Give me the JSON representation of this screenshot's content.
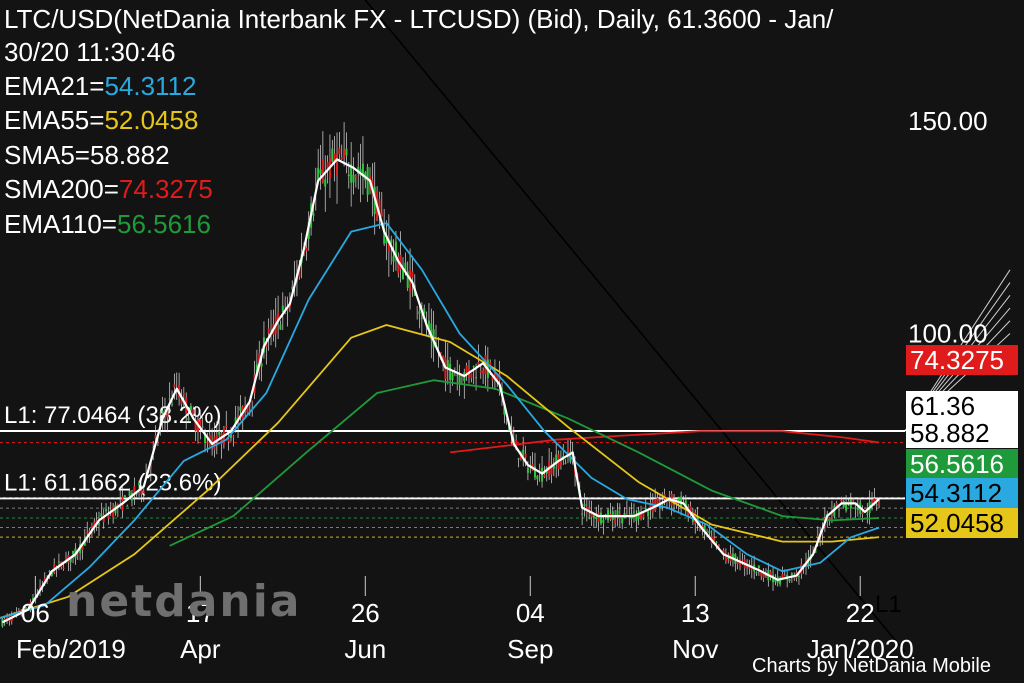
{
  "header": {
    "title": "LTC/USD(NetDania Interbank FX - LTCUSD) (Bid),  Daily, 61.3600 - Jan/",
    "timestamp": "30/20 11:30:46"
  },
  "indicators": [
    {
      "name": "EMA21=",
      "value": "54.3112",
      "color": "#29a9e0"
    },
    {
      "name": "EMA55=",
      "value": "52.0458",
      "color": "#e6c619"
    },
    {
      "name": "SMA5=",
      "value": "58.882",
      "color": "#ffffff"
    },
    {
      "name": "SMA200=",
      "value": "74.3275",
      "color": "#e01b1b"
    },
    {
      "name": "EMA110=",
      "value": "56.5616",
      "color": "#1e9a3a"
    }
  ],
  "fib_levels": [
    {
      "label": "L1: 77.0464 (38.2%)",
      "value": 77.0464
    },
    {
      "label": "L1: 61.1662 (23.6%)",
      "value": 61.1662
    }
  ],
  "trendline_label": "L1",
  "price_tags": [
    {
      "text": "74.3275",
      "value": 74.3275,
      "bg": "#e01b1b",
      "fg": "#ffffff"
    },
    {
      "text": "61.36",
      "value": 61.36,
      "bg": "#ffffff",
      "fg": "#000000"
    },
    {
      "text": "58.882",
      "value": 58.882,
      "bg": "#ffffff",
      "fg": "#000000"
    },
    {
      "text": "56.5616",
      "value": 56.5616,
      "bg": "#1e9a3a",
      "fg": "#ffffff"
    },
    {
      "text": "54.3112",
      "value": 54.3112,
      "bg": "#29a9e0",
      "fg": "#000000"
    },
    {
      "text": "52.0458",
      "value": 52.0458,
      "bg": "#e6c619",
      "fg": "#000000"
    }
  ],
  "watermark": "netdania",
  "credit": "Charts by NetDania Mobile",
  "chart_data": {
    "type": "line",
    "title": "LTC/USD(NetDania Interbank FX - LTCUSD) (Bid),  Daily, 61.3600 - Jan/30/20 11:30:46",
    "y_ticks": [
      {
        "label": "150.00",
        "value": 150
      },
      {
        "label": "100.00",
        "value": 100
      }
    ],
    "x_ticks": [
      {
        "day": "06",
        "month": "Feb/2019",
        "date": "2019-02-06"
      },
      {
        "day": "17",
        "month": "Apr",
        "date": "2019-04-17"
      },
      {
        "day": "26",
        "month": "Jun",
        "date": "2019-06-26"
      },
      {
        "day": "04",
        "month": "Sep",
        "date": "2019-09-04"
      },
      {
        "day": "13",
        "month": "Nov",
        "date": "2019-11-13"
      },
      {
        "day": "22",
        "month": "Jan/2020",
        "date": "2020-01-22"
      }
    ],
    "x_range": [
      "2019-01-22",
      "2020-02-10"
    ],
    "y_range": [
      25,
      175
    ],
    "grid": false,
    "trendline": {
      "start": [
        "2019-05-25",
        200
      ],
      "end": [
        "2020-02-10",
        25
      ]
    },
    "series": [
      {
        "name": "SMA5",
        "color": "#ffffff",
        "points": [
          [
            "2019-01-23",
            32
          ],
          [
            "2019-02-03",
            35
          ],
          [
            "2019-02-13",
            44
          ],
          [
            "2019-02-23",
            48
          ],
          [
            "2019-03-05",
            56
          ],
          [
            "2019-03-15",
            60
          ],
          [
            "2019-03-24",
            64
          ],
          [
            "2019-04-01",
            80
          ],
          [
            "2019-04-07",
            87
          ],
          [
            "2019-04-14",
            80
          ],
          [
            "2019-04-22",
            74
          ],
          [
            "2019-04-30",
            77
          ],
          [
            "2019-05-08",
            84
          ],
          [
            "2019-05-14",
            97
          ],
          [
            "2019-05-20",
            103
          ],
          [
            "2019-05-25",
            107
          ],
          [
            "2019-05-31",
            120
          ],
          [
            "2019-06-06",
            136
          ],
          [
            "2019-06-14",
            141
          ],
          [
            "2019-06-21",
            139
          ],
          [
            "2019-06-28",
            136
          ],
          [
            "2019-07-04",
            124
          ],
          [
            "2019-07-10",
            117
          ],
          [
            "2019-07-16",
            112
          ],
          [
            "2019-07-22",
            102
          ],
          [
            "2019-07-30",
            92
          ],
          [
            "2019-08-07",
            90
          ],
          [
            "2019-08-15",
            93
          ],
          [
            "2019-08-22",
            88
          ],
          [
            "2019-08-28",
            74
          ],
          [
            "2019-09-03",
            69
          ],
          [
            "2019-09-09",
            67
          ],
          [
            "2019-09-16",
            70
          ],
          [
            "2019-09-22",
            72
          ],
          [
            "2019-09-26",
            59
          ],
          [
            "2019-10-03",
            57
          ],
          [
            "2019-10-10",
            57
          ],
          [
            "2019-10-18",
            57
          ],
          [
            "2019-10-26",
            59
          ],
          [
            "2019-11-02",
            61
          ],
          [
            "2019-11-08",
            60
          ],
          [
            "2019-11-16",
            54
          ],
          [
            "2019-11-25",
            48
          ],
          [
            "2019-12-03",
            46
          ],
          [
            "2019-12-11",
            44
          ],
          [
            "2019-12-18",
            42
          ],
          [
            "2019-12-26",
            43
          ],
          [
            "2020-01-02",
            48
          ],
          [
            "2020-01-08",
            57
          ],
          [
            "2020-01-14",
            60
          ],
          [
            "2020-01-20",
            60
          ],
          [
            "2020-01-24",
            58
          ],
          [
            "2020-01-30",
            61
          ]
        ]
      },
      {
        "name": "EMA21",
        "color": "#29a9e0",
        "points": [
          [
            "2019-01-22",
            33
          ],
          [
            "2019-02-10",
            36
          ],
          [
            "2019-03-01",
            45
          ],
          [
            "2019-03-20",
            56
          ],
          [
            "2019-04-10",
            70
          ],
          [
            "2019-04-28",
            75
          ],
          [
            "2019-05-15",
            86
          ],
          [
            "2019-06-02",
            108
          ],
          [
            "2019-06-20",
            124
          ],
          [
            "2019-07-05",
            126
          ],
          [
            "2019-07-20",
            115
          ],
          [
            "2019-08-05",
            100
          ],
          [
            "2019-08-25",
            88
          ],
          [
            "2019-09-10",
            77
          ],
          [
            "2019-09-30",
            66
          ],
          [
            "2019-10-15",
            61
          ],
          [
            "2019-11-01",
            59
          ],
          [
            "2019-11-18",
            55
          ],
          [
            "2019-12-05",
            48
          ],
          [
            "2019-12-20",
            44
          ],
          [
            "2020-01-05",
            46
          ],
          [
            "2020-01-18",
            52
          ],
          [
            "2020-01-30",
            54.3
          ]
        ]
      },
      {
        "name": "EMA55",
        "color": "#e6c619",
        "points": [
          [
            "2019-01-22",
            33
          ],
          [
            "2019-02-20",
            38
          ],
          [
            "2019-03-20",
            48
          ],
          [
            "2019-04-20",
            63
          ],
          [
            "2019-05-20",
            79
          ],
          [
            "2019-06-20",
            99
          ],
          [
            "2019-07-05",
            102
          ],
          [
            "2019-08-01",
            98
          ],
          [
            "2019-08-25",
            90
          ],
          [
            "2019-09-20",
            78
          ],
          [
            "2019-10-20",
            65
          ],
          [
            "2019-11-20",
            55
          ],
          [
            "2019-12-20",
            51
          ],
          [
            "2020-01-10",
            51
          ],
          [
            "2020-01-30",
            52.05
          ]
        ]
      },
      {
        "name": "EMA110",
        "color": "#1e9a3a",
        "points": [
          [
            "2019-04-04",
            50
          ],
          [
            "2019-05-01",
            57
          ],
          [
            "2019-06-01",
            72
          ],
          [
            "2019-07-01",
            86
          ],
          [
            "2019-07-25",
            89
          ],
          [
            "2019-08-20",
            87
          ],
          [
            "2019-09-20",
            80
          ],
          [
            "2019-10-20",
            72
          ],
          [
            "2019-11-20",
            63
          ],
          [
            "2019-12-20",
            57
          ],
          [
            "2020-01-10",
            56
          ],
          [
            "2020-01-30",
            56.56
          ]
        ]
      },
      {
        "name": "SMA200",
        "color": "#e01b1b",
        "points": [
          [
            "2019-08-01",
            72
          ],
          [
            "2019-09-15",
            75
          ],
          [
            "2019-10-15",
            76
          ],
          [
            "2019-11-15",
            77
          ],
          [
            "2019-12-20",
            77
          ],
          [
            "2020-01-15",
            75.5
          ],
          [
            "2020-01-30",
            74.33
          ]
        ]
      }
    ]
  }
}
